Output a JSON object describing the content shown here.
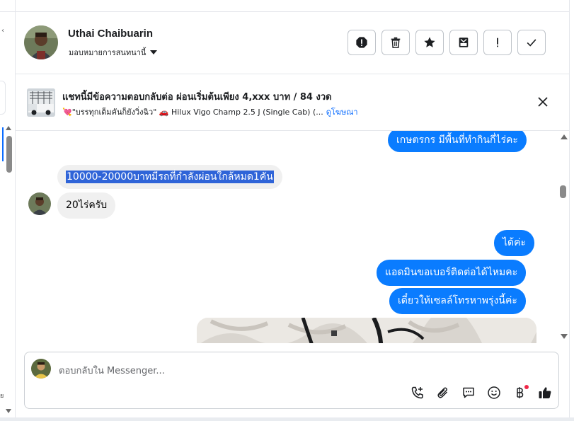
{
  "header": {
    "name": "Uthai Chaibuarin",
    "assign_label": "มอบหมายการสนทนานี้"
  },
  "actions": [
    {
      "icon": "spam-report-icon"
    },
    {
      "icon": "trash-icon"
    },
    {
      "icon": "star-icon"
    },
    {
      "icon": "archive-icon"
    },
    {
      "icon": "follow-up-icon"
    },
    {
      "icon": "checkmark-icon"
    }
  ],
  "ad": {
    "title": "แชทนี้มีข้อความตอบกลับต่อ ผ่อนเริ่มต้นเพียง 4,xxx บาท / 84 งวด",
    "subtitle": "💘\"บรรทุกเต็มคันก็ยังวิ่งฉิว\" 🚗 Hilux Vigo Champ 2.5 J (Single Cab) (...",
    "link": "ดูโฆษณา"
  },
  "messages": {
    "m1": "เกษตรกร มีพื้นที่ทำกินกี่ไร่คะ",
    "m2": "10000-20000บาทมีรถที่กำลังผ่อนใกล้หมด1คัน",
    "m3": "20ไร่ครับ",
    "m4": "ได้ค่ะ",
    "m5": "แอดมินขอเบอร์ติดต่อได้ไหมคะ",
    "m6": "เดี๋ยวให้เซลล์โทรหาพรุ่งนี้ค่ะ"
  },
  "composer": {
    "placeholder": "ตอบกลับใน Messenger..."
  },
  "tools": [
    "call-plus-icon",
    "attachment-icon",
    "saved-reply-icon",
    "emoji-icon",
    "baht-payment-icon",
    "thumbs-up-icon"
  ],
  "left_fragment": "ย",
  "colors": {
    "outgoing": "#0a7cff",
    "incoming": "#f0f0f0",
    "link": "#0a6cff",
    "highlight": "#2f64d8"
  }
}
